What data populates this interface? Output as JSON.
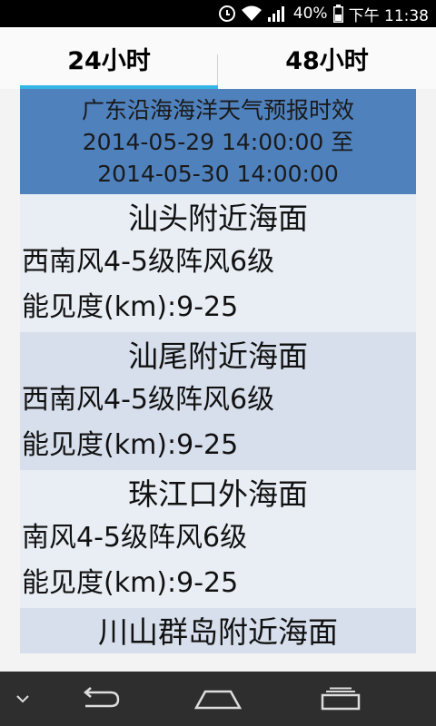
{
  "status_bar": {
    "battery_text": "40%",
    "time": "下午 11:38",
    "icons": [
      "alarm-icon",
      "wifi-icon",
      "signal-icon",
      "battery-icon"
    ]
  },
  "tabs": [
    {
      "label": "24小时",
      "selected": true
    },
    {
      "label": "48小时",
      "selected": false
    }
  ],
  "header": {
    "title": "广东沿海海洋天气预报时效",
    "start": "2014-05-29 14:00:00 至",
    "end": "2014-05-30 14:00:00"
  },
  "areas": [
    {
      "name": "汕头附近海面",
      "wind": "西南风4-5级阵风6级",
      "visibility": "能见度(km):9-25"
    },
    {
      "name": "汕尾附近海面",
      "wind": "西南风4-5级阵风6级",
      "visibility": "能见度(km):9-25"
    },
    {
      "name": "珠江口外海面",
      "wind": "南风4-5级阵风6级",
      "visibility": "能见度(km):9-25"
    },
    {
      "name": "川山群岛附近海面"
    }
  ],
  "colors": {
    "accent": "#34b5e5",
    "header_bg": "#4f81bd",
    "row_light": "#e9eef5",
    "row_dark": "#d7dfec"
  },
  "nav_bar": {
    "icons": [
      "menu-chevron-icon",
      "back-icon",
      "home-icon",
      "recent-apps-icon"
    ]
  }
}
